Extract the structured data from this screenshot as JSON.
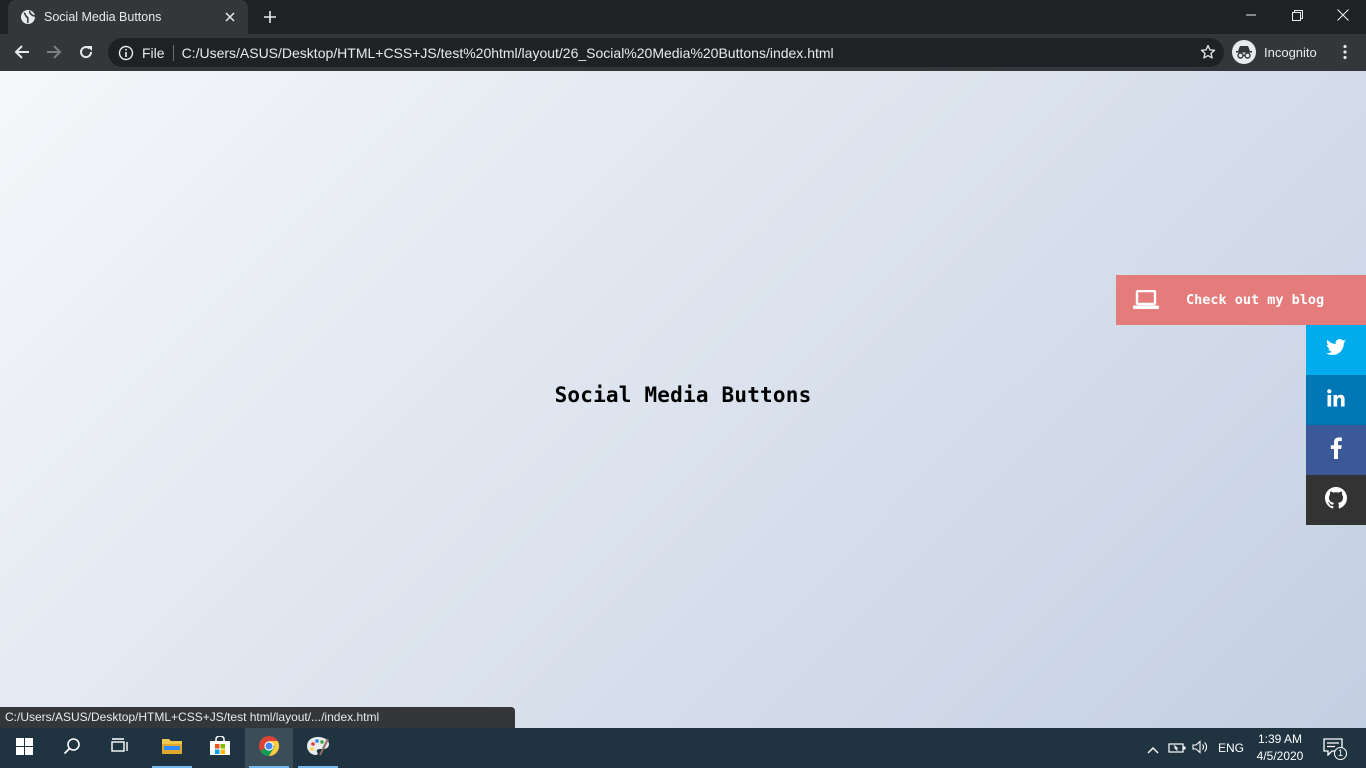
{
  "browser": {
    "tab": {
      "title": "Social Media Buttons"
    },
    "omnibox": {
      "scheme": "File",
      "url": "C:/Users/ASUS/Desktop/HTML+CSS+JS/test%20html/layout/26_Social%20Media%20Buttons/index.html"
    },
    "profile": {
      "label": "Incognito"
    },
    "status_url": "C:/Users/ASUS/Desktop/HTML+CSS+JS/test html/layout/.../index.html"
  },
  "page": {
    "heading": "Social Media Buttons",
    "blog_button": {
      "label": "Check out my blog",
      "color": "#e57c7c",
      "icon": "laptop-icon"
    },
    "social_links": [
      {
        "name": "twitter",
        "icon": "twitter-icon",
        "color": "#00acee"
      },
      {
        "name": "linkedin",
        "icon": "linkedin-icon",
        "color": "#0077b5"
      },
      {
        "name": "facebook",
        "icon": "facebook-icon",
        "color": "#3b5998"
      },
      {
        "name": "github",
        "icon": "github-icon",
        "color": "#333333"
      }
    ],
    "background_gradient": [
      "#f5f7fa",
      "#c3cfe2"
    ]
  },
  "taskbar": {
    "apps": [
      "start-icon",
      "search-icon",
      "task-view-icon",
      "file-explorer-icon",
      "store-icon",
      "chrome-icon",
      "paint-icon"
    ],
    "language": "ENG",
    "time": "1:39 AM",
    "date": "4/5/2020",
    "notification_count": "1"
  }
}
